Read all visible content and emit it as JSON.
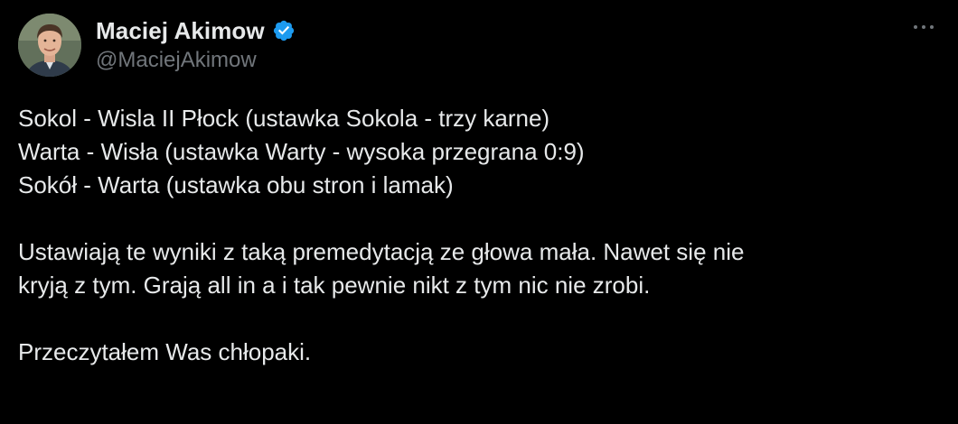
{
  "author": {
    "display_name": "Maciej Akimow",
    "handle": "@MaciejAkimow",
    "verified": true,
    "avatar_icon": "person-avatar",
    "verified_color": "#1d9bf0"
  },
  "menu": {
    "icon": "more-horizontal-icon"
  },
  "tweet": {
    "lines": [
      "Sokol - Wisla II Płock  (ustawka Sokola - trzy karne)",
      "Warta - Wisła (ustawka Warty - wysoka przegrana 0:9)",
      "Sokół - Warta (ustawka obu stron i lamak)",
      "Ustawiają te wyniki z taką premedytacją ze głowa mała. Nawet się nie",
      "kryją z tym. Grają all in a i tak pewnie nikt z tym nic nie zrobi.",
      "Przeczytałem Was chłopaki."
    ]
  },
  "colors": {
    "background": "#000000",
    "primary_text": "#e7e9ea",
    "secondary_text": "#71767b"
  }
}
